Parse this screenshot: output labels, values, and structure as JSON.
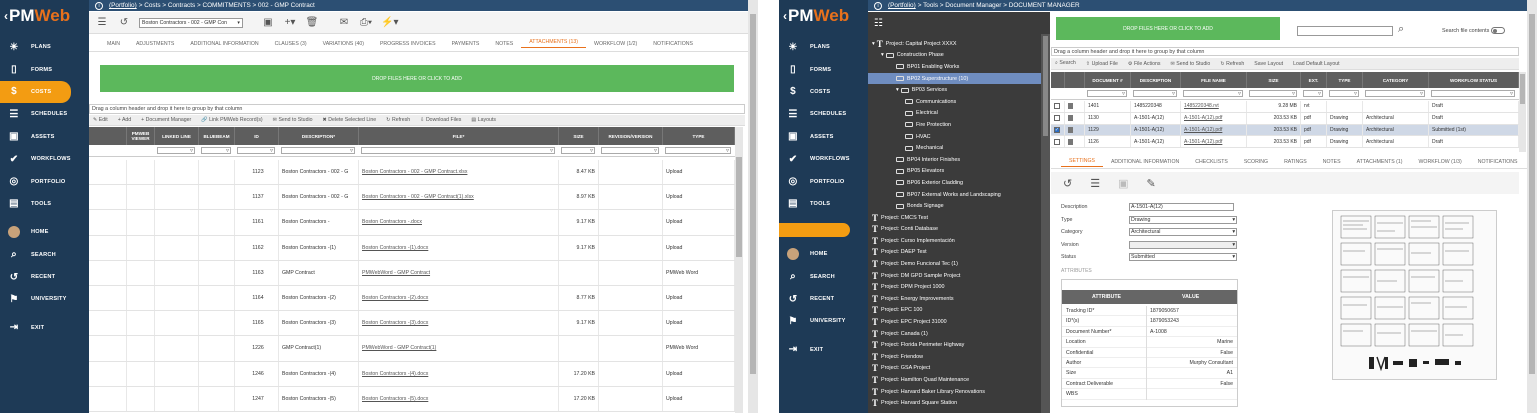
{
  "left": {
    "nav": {
      "logo": {
        "lt": "‹",
        "pm": "PM",
        "web": "Web"
      },
      "items": [
        {
          "icon": "☀",
          "label": "PLANS"
        },
        {
          "icon": "▯",
          "label": "FORMS"
        },
        {
          "icon": "$",
          "label": "COSTS",
          "active": true
        },
        {
          "icon": "☰",
          "label": "SCHEDULES"
        },
        {
          "icon": "▣",
          "label": "ASSETS"
        },
        {
          "icon": "✔",
          "label": "WORKFLOWS"
        },
        {
          "icon": "◎",
          "label": "PORTFOLIO"
        },
        {
          "icon": "▤",
          "label": "TOOLS"
        },
        {
          "icon": "avatar",
          "label": "HOME"
        },
        {
          "icon": "⌕",
          "label": "SEARCH"
        },
        {
          "icon": "↺",
          "label": "RECENT"
        },
        {
          "icon": "⚑",
          "label": "UNIVERSITY"
        },
        {
          "icon": "⇥",
          "label": "EXIT"
        }
      ]
    },
    "breadcrumb": {
      "link": "(Portfolio)",
      "rest": "> Costs > Contracts > COMMITMENTS > 002 - GMP Contract"
    },
    "record_select": "Boston Contractors - 002 - GMP Con",
    "tabs": [
      "MAIN",
      "ADJUSTMENTS",
      "ADDITIONAL INFORMATION",
      "CLAUSES (3)",
      "VARIATIONS (40)",
      "PROGRESS INVOICES",
      "PAYMENTS",
      "NOTES",
      "ATTACHMENTS (13)",
      "WORKFLOW (1/2)",
      "NOTIFICATIONS"
    ],
    "active_tab": 8,
    "drop_text": "DROP FILES HERE OR CLICK TO ADD",
    "group_text": "Drag a column header and drop it here to group by that column",
    "actions": [
      "Edit",
      "Add",
      "Document Manager",
      "Link PMWeb Record(s)",
      "Send to Studio",
      "Delete Selected Line",
      "Refresh",
      "Download Files",
      "Layouts"
    ],
    "action_icons": [
      "✎",
      "+",
      "+",
      "🔗",
      "✉",
      "✖",
      "↻",
      "⇩",
      "▤"
    ],
    "columns": [
      "",
      "PMWEB VIEWER",
      "LINKED LINE",
      "BLUEBEAM",
      "ID",
      "DESCRIPTION*",
      "FILE*",
      "SIZE",
      "REVISION/VERSION",
      "TYPE"
    ],
    "rows": [
      {
        "id": "1123",
        "desc": "Boston Contractors - 002 - G",
        "file": "Boston Contractors - 002 - GMP Contract.xlsx",
        "size": "8.47 KB",
        "rev": "",
        "type": "Upload"
      },
      {
        "id": "1137",
        "desc": "Boston Contractors - 002 - G",
        "file": "Boston Contractors - 002 - GMP Contract(1).xlsx",
        "size": "8.97 KB",
        "rev": "",
        "type": "Upload"
      },
      {
        "id": "1161",
        "desc": "Boston Contractors -",
        "file": "Boston Contractors -.docx",
        "size": "9.17 KB",
        "rev": "",
        "type": "Upload"
      },
      {
        "id": "1162",
        "desc": "Boston Contractors -(1)",
        "file": "Boston Contractors -(1).docx",
        "size": "9.17 KB",
        "rev": "",
        "type": "Upload"
      },
      {
        "id": "1163",
        "desc": "GMP Contract",
        "file": "PMWebWord - GMP Contract",
        "size": "",
        "rev": "",
        "type": "PMWeb Word"
      },
      {
        "id": "1164",
        "desc": "Boston Contractors -(2)",
        "file": "Boston Contractors -(2).docx",
        "size": "8.77 KB",
        "rev": "",
        "type": "Upload"
      },
      {
        "id": "1165",
        "desc": "Boston Contractors -(3)",
        "file": "Boston Contractors -(3).docx",
        "size": "9.17 KB",
        "rev": "",
        "type": "Upload"
      },
      {
        "id": "1226",
        "desc": "GMP Contract(1)",
        "file": "PMWebWord - GMP Contract(1)",
        "size": "",
        "rev": "",
        "type": "PMWeb Word"
      },
      {
        "id": "1246",
        "desc": "Boston Contractors -(4)",
        "file": "Boston Contractors -(4).docx",
        "size": "17.20 KB",
        "rev": "",
        "type": "Upload"
      },
      {
        "id": "1247",
        "desc": "Boston Contractors -(5)",
        "file": "Boston Contractors -(5).docx",
        "size": "17.20 KB",
        "rev": "",
        "type": "Upload"
      }
    ]
  },
  "right": {
    "breadcrumb": {
      "link": "(Portfolio)",
      "rest": "> Tools > Document Manager > DOCUMENT MANAGER"
    },
    "drop_text": "DROP FILES HERE OR CLICK TO ADD",
    "search_label": "Search file contents",
    "tree": [
      {
        "lvl": 0,
        "t": "Project: Capital Project XXXX",
        "kind": "proj",
        "exp": "▾"
      },
      {
        "lvl": 1,
        "t": "Construction Phase",
        "kind": "folder",
        "exp": "▾"
      },
      {
        "lvl": 2,
        "t": "BP01 Enabling Works",
        "kind": "folder"
      },
      {
        "lvl": 2,
        "t": "BP02 Superstructure (10)",
        "kind": "folder",
        "sel": true
      },
      {
        "lvl": 2,
        "t": "BP03 Services",
        "kind": "folder",
        "exp": "▾"
      },
      {
        "lvl": 3,
        "t": "Communications",
        "kind": "folder"
      },
      {
        "lvl": 3,
        "t": "Electrical",
        "kind": "folder"
      },
      {
        "lvl": 3,
        "t": "Fire Protection",
        "kind": "folder"
      },
      {
        "lvl": 3,
        "t": "HVAC",
        "kind": "folder"
      },
      {
        "lvl": 3,
        "t": "Mechanical",
        "kind": "folder"
      },
      {
        "lvl": 2,
        "t": "BP04 Interior Finishes",
        "kind": "folder"
      },
      {
        "lvl": 2,
        "t": "BP05 Elevators",
        "kind": "folder"
      },
      {
        "lvl": 2,
        "t": "BP06 Exterior Cladding",
        "kind": "folder"
      },
      {
        "lvl": 2,
        "t": "BP07 External Works and Landscaping",
        "kind": "folder"
      },
      {
        "lvl": 2,
        "t": "Bonds Signage",
        "kind": "folder"
      },
      {
        "lvl": 0,
        "t": "Project: CMCS Test",
        "kind": "proj"
      },
      {
        "lvl": 0,
        "t": "Project: Conti Database",
        "kind": "proj"
      },
      {
        "lvl": 0,
        "t": "Project: Curso Implementación",
        "kind": "proj"
      },
      {
        "lvl": 0,
        "t": "Project: DAEP Test",
        "kind": "proj"
      },
      {
        "lvl": 0,
        "t": "Project: Demo Funcional Tec (1)",
        "kind": "proj"
      },
      {
        "lvl": 0,
        "t": "Project: DM GPD Sample Project",
        "kind": "proj"
      },
      {
        "lvl": 0,
        "t": "Project: DPM Project 1000",
        "kind": "proj"
      },
      {
        "lvl": 0,
        "t": "Project: Energy Improvements",
        "kind": "proj"
      },
      {
        "lvl": 0,
        "t": "Project: EPC 100",
        "kind": "proj"
      },
      {
        "lvl": 0,
        "t": "Project: EPC Project 31000",
        "kind": "proj"
      },
      {
        "lvl": 0,
        "t": "Project: Canada (1)",
        "kind": "proj"
      },
      {
        "lvl": 0,
        "t": "Project: Florida Perimeter Highway",
        "kind": "proj"
      },
      {
        "lvl": 0,
        "t": "Project: Friendow",
        "kind": "proj"
      },
      {
        "lvl": 0,
        "t": "Project: GSA Project",
        "kind": "proj"
      },
      {
        "lvl": 0,
        "t": "Project: Hamilton Quad Maintenance",
        "kind": "proj"
      },
      {
        "lvl": 0,
        "t": "Project: Harvard Baker Library Renovations",
        "kind": "proj"
      },
      {
        "lvl": 0,
        "t": "Project: Harvard Square Station",
        "kind": "proj"
      }
    ],
    "group_text": "Drag a column header and drop it here to group by that column",
    "actions": [
      "Search",
      "Upload File",
      "File Actions",
      "Send to Studio",
      "Refresh",
      "Save Layout",
      "Load Default Layout"
    ],
    "action_icons": [
      "⌕",
      "⇧",
      "⚙",
      "✉",
      "↻",
      "",
      ""
    ],
    "columns": [
      "",
      "",
      "DOCUMENT #",
      "DESCRIPTION",
      "FILE NAME",
      "SIZE",
      "EXT.",
      "TYPE",
      "CATEGORY",
      "WORKFLOW STATUS"
    ],
    "rows": [
      {
        "chk": false,
        "doc": "1401",
        "desc": "1485220348",
        "file": "1485220348.rvt",
        "size": "9.28 MB",
        "ext": "rvt",
        "type": "",
        "cat": "",
        "st": "Draft"
      },
      {
        "chk": false,
        "doc": "1130",
        "desc": "A-1501-A(12)",
        "file": "A-1501-A(12).pdf",
        "size": "203.53 KB",
        "ext": "pdf",
        "type": "Drawing",
        "cat": "Architectural",
        "st": "Draft"
      },
      {
        "chk": true,
        "doc": "1129",
        "desc": "A-1501-A(12)",
        "file": "A-1501-A(12).pdf",
        "size": "203.53 KB",
        "ext": "pdf",
        "type": "Drawing",
        "cat": "Architectural",
        "st": "Submitted (1st)"
      },
      {
        "chk": false,
        "doc": "1126",
        "desc": "A-1501-A(12)",
        "file": "A-1501-A(12).pdf",
        "size": "203.53 KB",
        "ext": "pdf",
        "type": "Drawing",
        "cat": "Architectural",
        "st": "Draft"
      }
    ],
    "tabs": [
      "SETTINGS",
      "ADDITIONAL INFORMATION",
      "CHECKLISTS",
      "SCORING",
      "RATINGS",
      "NOTES",
      "ATTACHMENTS (1)",
      "WORKFLOW (1/3)",
      "NOTIFICATIONS"
    ],
    "active_tab": 0,
    "props": [
      {
        "label": "Description",
        "value": "A-1501-A(12)",
        "dd": false
      },
      {
        "label": "Type",
        "value": "Drawing",
        "dd": true
      },
      {
        "label": "Category",
        "value": "Architectural",
        "dd": true
      },
      {
        "label": "Version",
        "value": "",
        "dd": true
      },
      {
        "label": "Status",
        "value": "Submitted",
        "dd": true
      }
    ],
    "attributes_label": "ATTRIBUTES",
    "attr_cols": [
      "ATTRIBUTE",
      "VALUE"
    ],
    "attrs": [
      {
        "k": "Tracking ID*",
        "v": "1879050657"
      },
      {
        "k": "ID*(s)",
        "v": "1879053243"
      },
      {
        "k": "Document Number*",
        "v": "A-1008"
      },
      {
        "k": "Location",
        "v": "Marine"
      },
      {
        "k": "Confidential",
        "v": "False"
      },
      {
        "k": "Author",
        "v": "Murphy Consultant"
      },
      {
        "k": "Size",
        "v": "A1"
      },
      {
        "k": "Contract Deliverable",
        "v": "False"
      },
      {
        "k": "WBS",
        "v": ""
      }
    ]
  },
  "colors": {
    "nav": "#1e3a56",
    "breadcrumb": "#2c4f73",
    "accent": "#e8711c",
    "drop": "#5cb85c",
    "tree": "#3b3b3b"
  }
}
